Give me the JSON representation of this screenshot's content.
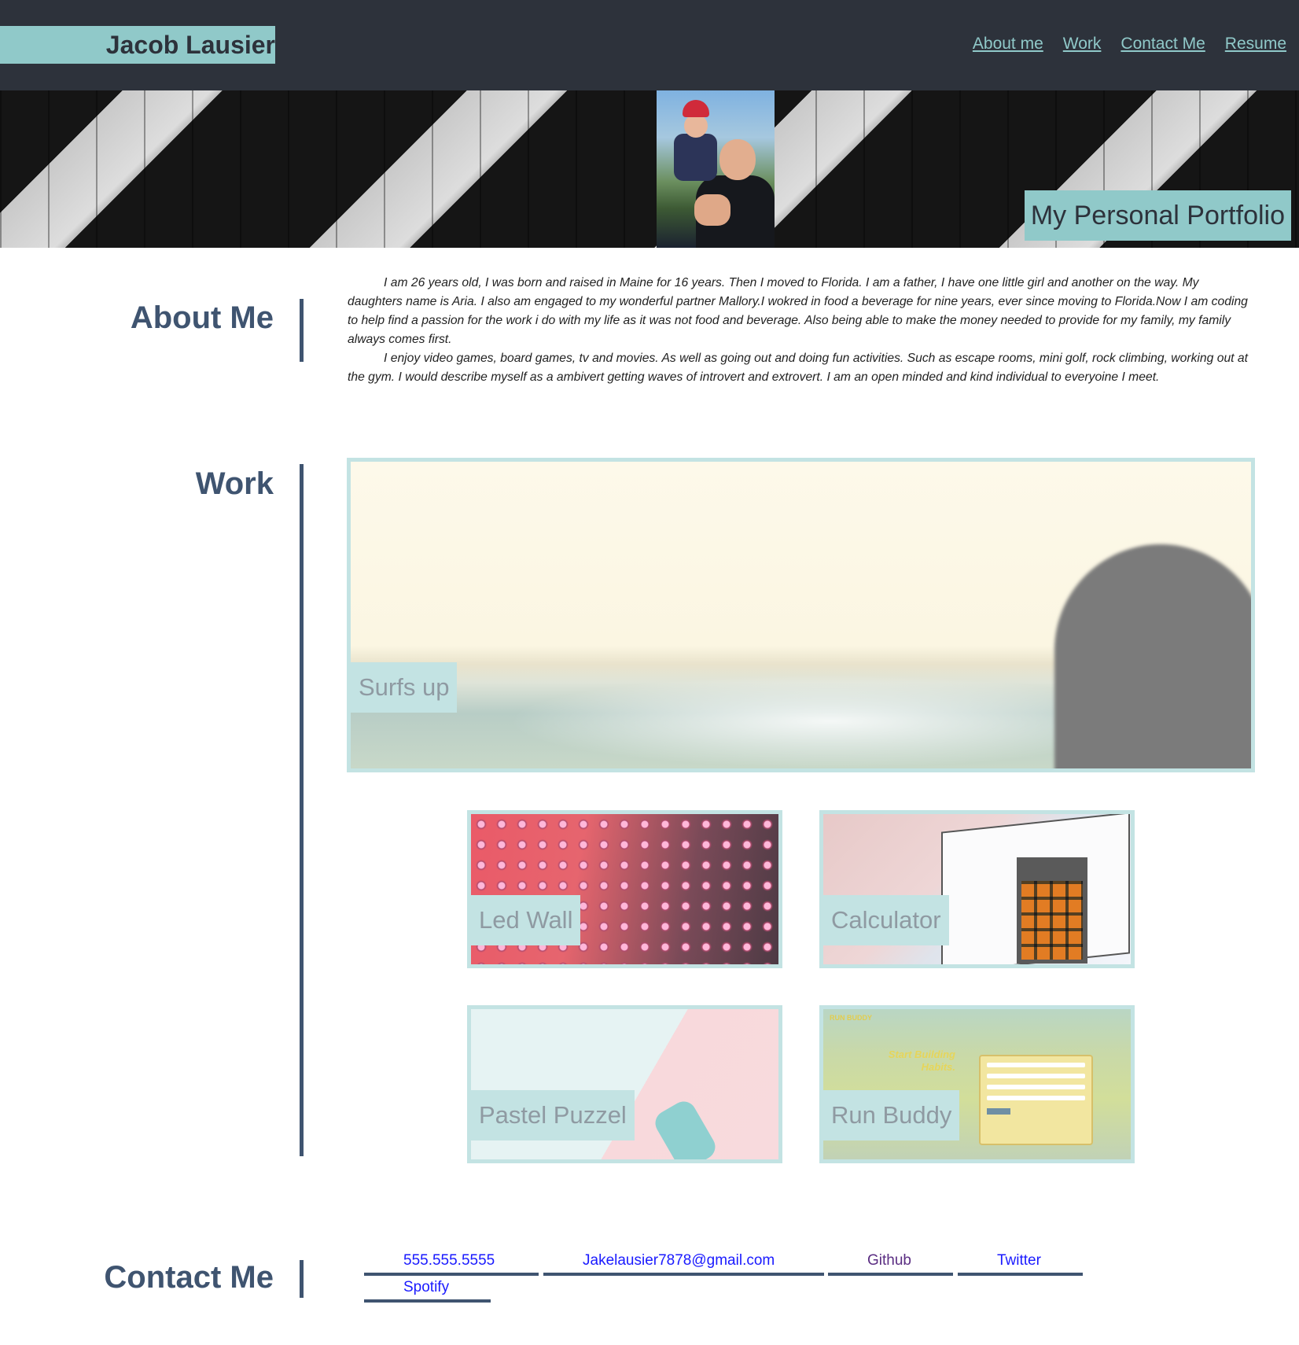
{
  "header": {
    "brand": "Jacob Lausier",
    "nav": [
      "About me",
      "Work",
      "Contact Me",
      "Resume"
    ]
  },
  "hero": {
    "title": "My Personal Portfolio"
  },
  "about": {
    "title": "About Me",
    "paragraphs": [
      "I am 26 years old, I was born and raised in Maine for 16 years. Then I moved to Florida. I am a father, I have one little girl and another on the way. My daughters name is Aria. I also am engaged to my wonderful partner Mallory.I wokred in food a beverage for nine years, ever since moving to Florida.Now I am coding to help find a passion for the work i do with my life as it was not food and beverage. Also being able to make the money needed to provide for my family, my family always comes first.",
      "I enjoy video games, board games, tv and movies. As well as going out and doing fun activities. Such as escape rooms, mini golf, rock climbing, working out at the gym. I would describe myself as a ambivert getting waves of introvert and extrovert. I am an open minded and kind individual to everyoine I meet."
    ]
  },
  "work": {
    "title": "Work",
    "projects": [
      {
        "label": "Surfs up"
      },
      {
        "label": "Led Wall"
      },
      {
        "label": "Calculator"
      },
      {
        "label": "Pastel Puzzel"
      },
      {
        "label": "Run Buddy",
        "screenshot": {
          "brand": "RUN BUDDY",
          "headline": "Start Building Habits."
        }
      }
    ]
  },
  "contact": {
    "title": "Contact Me",
    "links": [
      "555.555.5555",
      "Jakelausier7878@gmail.com",
      "Github",
      "Twitter",
      "Spotify"
    ]
  },
  "colors": {
    "header_bg": "#2d323b",
    "accent": "#90c9c9",
    "heading": "#3f5470",
    "card_border": "#c3e3e3",
    "link": "#1a1aff",
    "visited_link": "#5a2d82"
  }
}
